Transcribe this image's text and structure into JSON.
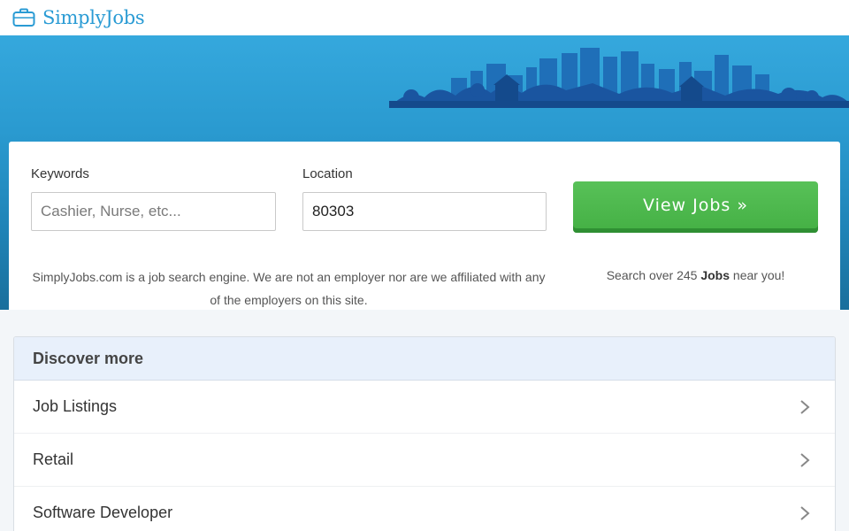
{
  "brand": {
    "name": "SimplyJobs",
    "color": "#2a9bd4"
  },
  "search": {
    "keywords_label": "Keywords",
    "keywords_placeholder": "Cashier, Nurse, etc...",
    "keywords_value": "",
    "location_label": "Location",
    "location_value": "80303",
    "button_label": "View Jobs »"
  },
  "disclaimer": "SimplyJobs.com is a job search engine. We are not an employer nor are we affiliated with any of the employers on this site.",
  "job_count": {
    "prefix": "Search over 245 ",
    "emphasis": "Jobs",
    "suffix": " near you!"
  },
  "discover": {
    "title": "Discover more",
    "items": [
      {
        "label": "Job Listings"
      },
      {
        "label": "Retail"
      },
      {
        "label": "Software Developer"
      }
    ]
  },
  "icons": {
    "logo": "briefcase-icon",
    "item_arrow": "chevron-right-icon"
  },
  "colors": {
    "hero_top": "#35a8dd",
    "hero_bottom": "#1a6f9c",
    "button_green": "#4cb74c",
    "panel_header": "#e8f0fb"
  }
}
